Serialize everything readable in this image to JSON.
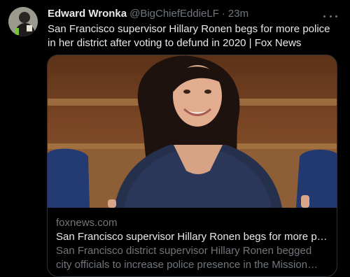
{
  "author": {
    "name": "Edward Wronka",
    "handle": "@BigChiefEddieLF",
    "separator": "·",
    "time": "23m"
  },
  "tweet": {
    "text": "San Francisco supervisor Hillary Ronen begs for more police in her district after voting to defund in 2020 | Fox News"
  },
  "card": {
    "domain": "foxnews.com",
    "title": "San Francisco supervisor Hillary Ronen begs for more polic...",
    "description": "San Francisco district supervisor Hillary Ronen begged city officials to increase police presence in the Mission District..."
  },
  "icons": {
    "more": "more-horizontal-icon"
  },
  "colors": {
    "background": "#000000",
    "primary_text": "#e7e9ea",
    "secondary_text": "#71767b",
    "border": "#2f3336"
  }
}
